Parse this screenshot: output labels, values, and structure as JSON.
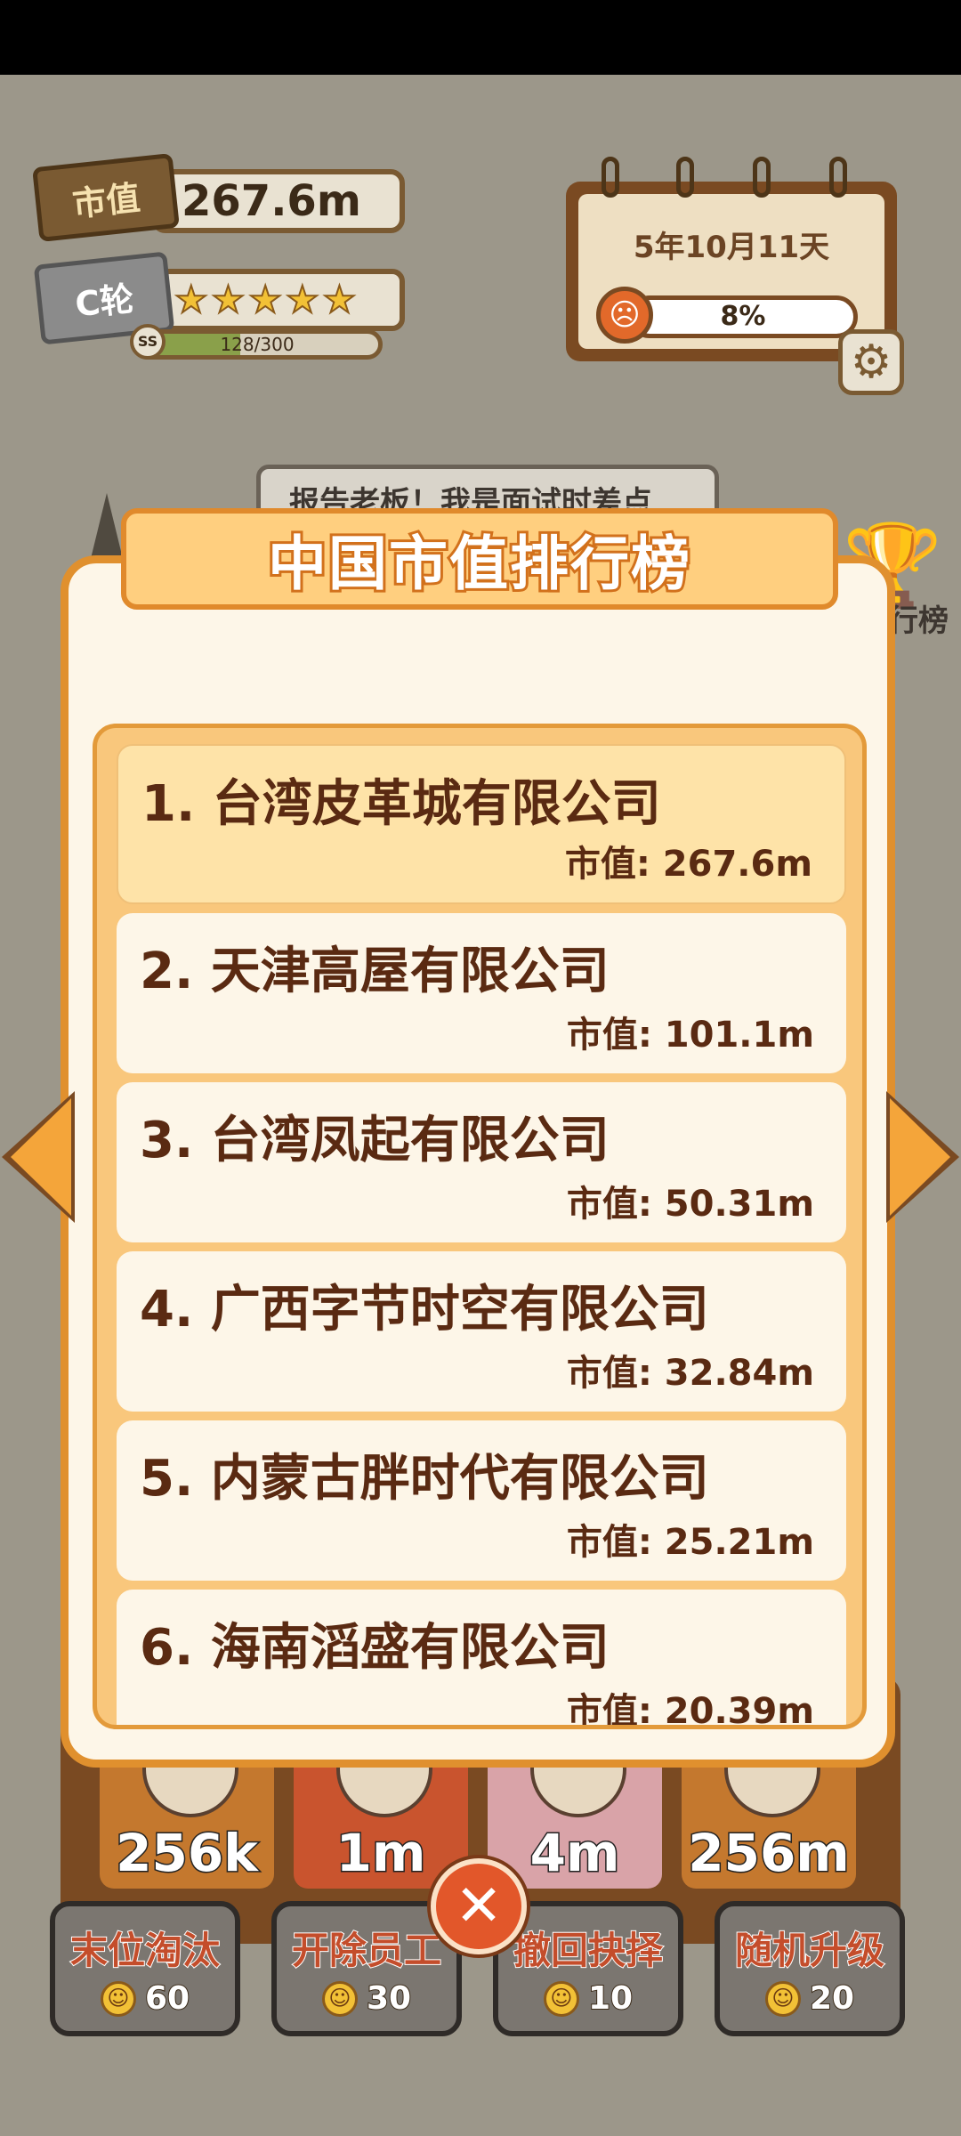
{
  "hud": {
    "market_tag": "市值",
    "market_value": "267.6m",
    "round_tag": "C轮",
    "stars": 5,
    "level_badge": "SS",
    "xp_text": "128/300",
    "xp_progress": 0.43
  },
  "calendar": {
    "date": "5年10月11天",
    "mood_percent": "8%",
    "mood_progress": 0.08
  },
  "background": {
    "speech_text": "报告老板！我是面试时差点",
    "trophy_label": "行榜"
  },
  "cards": [
    {
      "amount": "256k",
      "color": "#c4782e"
    },
    {
      "amount": "1m",
      "color": "#c9542e"
    },
    {
      "amount": "4m",
      "color": "#d9a3a8"
    },
    {
      "amount": "256m",
      "color": "#c4782e"
    }
  ],
  "actions": [
    {
      "label": "末位淘汰",
      "cost": "60"
    },
    {
      "label": "开除员工",
      "cost": "30"
    },
    {
      "label": "撤回抉择",
      "cost": "10"
    },
    {
      "label": "随机升级",
      "cost": "20"
    }
  ],
  "leaderboard": {
    "title": "中国市值排行榜",
    "entries": [
      {
        "name": "1. 台湾皮革城有限公司",
        "cap": "市值: 267.6m"
      },
      {
        "name": "2. 天津高屋有限公司",
        "cap": "市值: 101.1m"
      },
      {
        "name": "3. 台湾凤起有限公司",
        "cap": "市值: 50.31m"
      },
      {
        "name": "4. 广西字节时空有限公司",
        "cap": "市值: 32.84m"
      },
      {
        "name": "5. 内蒙古胖时代有限公司",
        "cap": "市值: 25.21m"
      },
      {
        "name": "6. 海南滔盛有限公司",
        "cap": "市值: 20.39m"
      }
    ]
  },
  "close_icon": "close-icon",
  "colors": {
    "panel_border": "#e0902e",
    "title_fill": "#ffcf7f",
    "highlight_row": "#fee3a8"
  }
}
